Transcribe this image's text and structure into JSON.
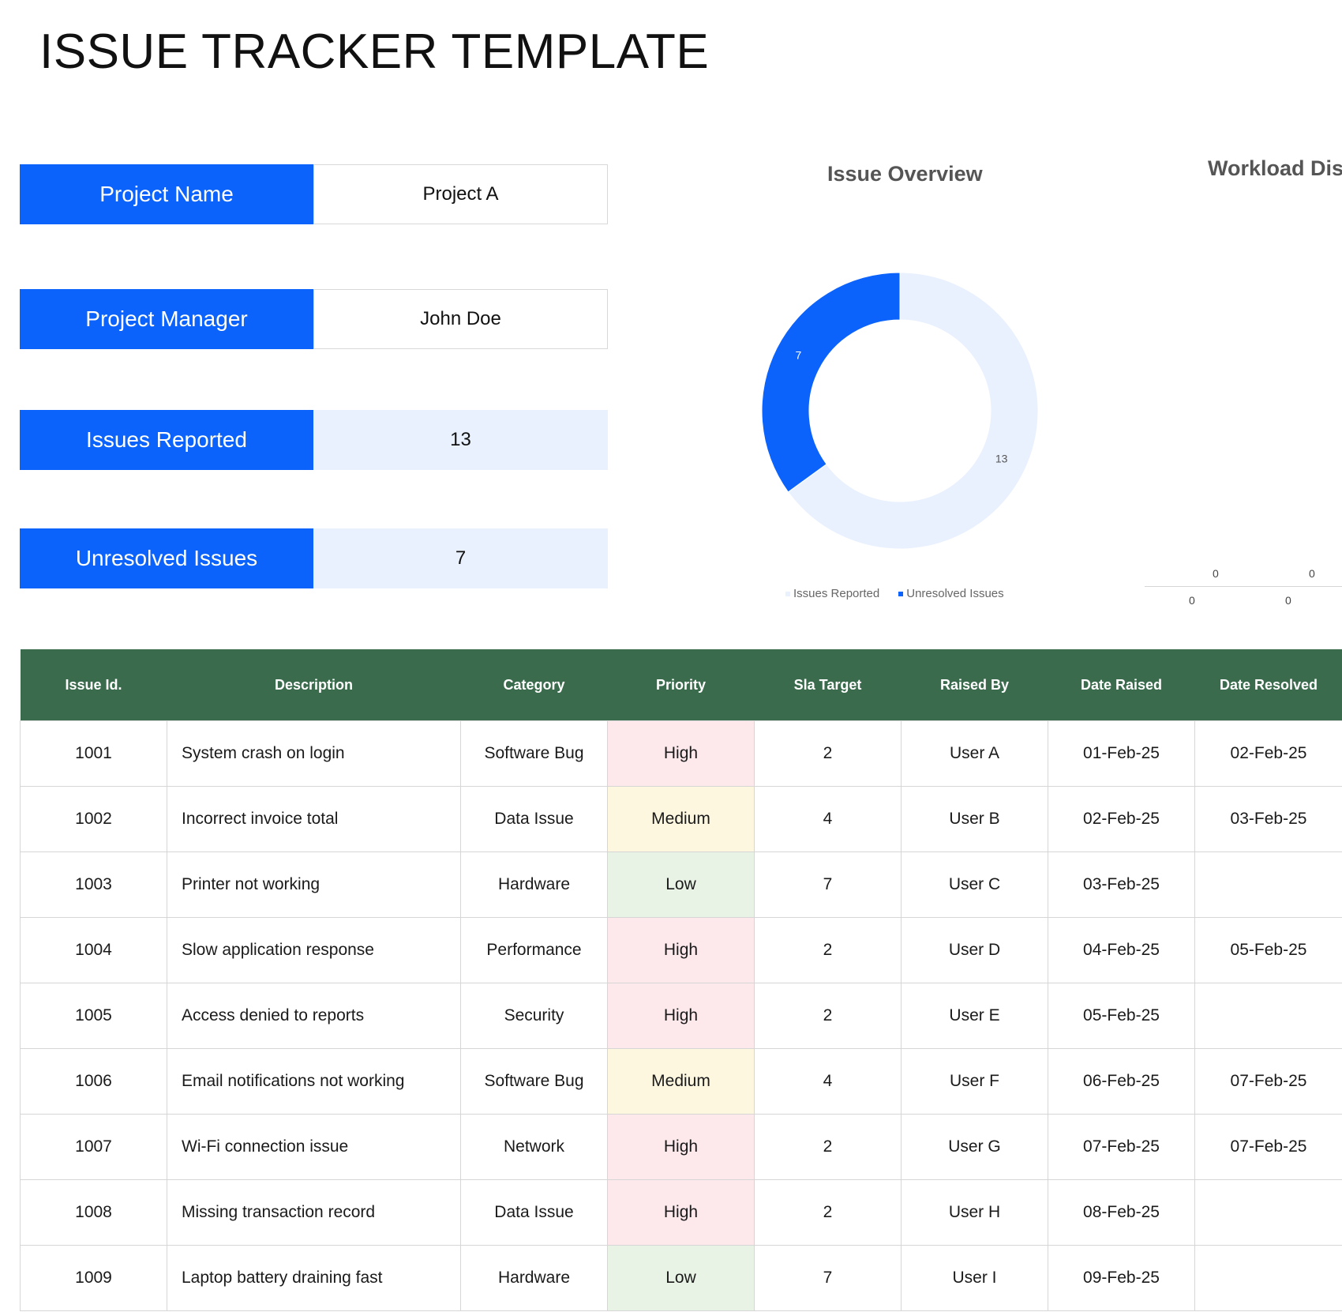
{
  "title": "ISSUE TRACKER TEMPLATE",
  "summary": {
    "project_name_label": "Project Name",
    "project_name": "Project A",
    "project_manager_label": "Project Manager",
    "project_manager": "John Doe",
    "issues_reported_label": "Issues Reported",
    "issues_reported": "13",
    "unresolved_label": "Unresolved Issues",
    "unresolved": "7"
  },
  "colors": {
    "accent_blue": "#0b63fc",
    "light_blue": "#e9f1fe",
    "header_green": "#3a6b4d",
    "high": "#fde8ec",
    "medium": "#fef7e0",
    "low": "#e8f3e5"
  },
  "chart_data": [
    {
      "type": "pie",
      "title": "Issue Overview",
      "series": [
        {
          "name": "Issues Reported",
          "value": 13,
          "color": "#e9f1fe"
        },
        {
          "name": "Unresolved Issues",
          "value": 7,
          "color": "#0b63fc"
        }
      ],
      "data_labels": [
        "13",
        "7"
      ],
      "legend": "bottom",
      "donut": true
    },
    {
      "type": "bar",
      "title": "Workload Dist",
      "values": [
        0,
        0
      ],
      "axis_labels": [
        "0",
        "0"
      ],
      "note_partial": true
    }
  ],
  "table": {
    "headers": [
      "Issue Id.",
      "Description",
      "Category",
      "Priority",
      "Sla Target",
      "Raised By",
      "Date Raised",
      "Date Resolved"
    ],
    "rows": [
      {
        "id": "1001",
        "desc": "System crash on login",
        "category": "Software Bug",
        "priority": "High",
        "sla": "2",
        "raised_by": "User A",
        "date_raised": "01-Feb-25",
        "date_resolved": "02-Feb-25"
      },
      {
        "id": "1002",
        "desc": "Incorrect invoice total",
        "category": "Data Issue",
        "priority": "Medium",
        "sla": "4",
        "raised_by": "User B",
        "date_raised": "02-Feb-25",
        "date_resolved": "03-Feb-25"
      },
      {
        "id": "1003",
        "desc": "Printer not working",
        "category": "Hardware",
        "priority": "Low",
        "sla": "7",
        "raised_by": "User C",
        "date_raised": "03-Feb-25",
        "date_resolved": ""
      },
      {
        "id": "1004",
        "desc": "Slow application response",
        "category": "Performance",
        "priority": "High",
        "sla": "2",
        "raised_by": "User D",
        "date_raised": "04-Feb-25",
        "date_resolved": "05-Feb-25"
      },
      {
        "id": "1005",
        "desc": "Access denied to reports",
        "category": "Security",
        "priority": "High",
        "sla": "2",
        "raised_by": "User E",
        "date_raised": "05-Feb-25",
        "date_resolved": ""
      },
      {
        "id": "1006",
        "desc": "Email notifications not working",
        "category": "Software Bug",
        "priority": "Medium",
        "sla": "4",
        "raised_by": "User F",
        "date_raised": "06-Feb-25",
        "date_resolved": "07-Feb-25"
      },
      {
        "id": "1007",
        "desc": "Wi-Fi connection issue",
        "category": "Network",
        "priority": "High",
        "sla": "2",
        "raised_by": "User G",
        "date_raised": "07-Feb-25",
        "date_resolved": "07-Feb-25"
      },
      {
        "id": "1008",
        "desc": "Missing transaction record",
        "category": "Data Issue",
        "priority": "High",
        "sla": "2",
        "raised_by": "User H",
        "date_raised": "08-Feb-25",
        "date_resolved": ""
      },
      {
        "id": "1009",
        "desc": "Laptop battery draining fast",
        "category": "Hardware",
        "priority": "Low",
        "sla": "7",
        "raised_by": "User I",
        "date_raised": "09-Feb-25",
        "date_resolved": ""
      }
    ]
  }
}
